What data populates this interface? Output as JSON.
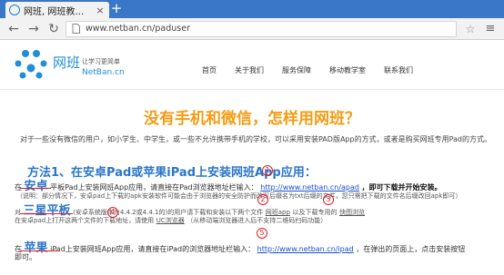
{
  "browser": {
    "tab_title": "网班, 网班教…",
    "url": "www.netban.cn/paduser"
  },
  "site": {
    "logo_cn": "网班",
    "logo_slogan": "让学习更简单",
    "logo_en": "NetBan.cn",
    "nav": [
      "首页",
      "关于我们",
      "服务保障",
      "移动教学室",
      "联系我们"
    ]
  },
  "content": {
    "title": "没有手机和微信，怎样用网班？",
    "intro": "对于一些没有微信的用户，如小学生、中学生，或一些不允许携带手机的学校，可以采用安装PAD版App的方式，或者是购买网班专用Pad的方式。",
    "method1": "方法1、在安卓Pad或苹果iPad上安装网班App应用：",
    "android": {
      "prefix": "在",
      "brand": "安卓",
      "text": "平板Pad上安装网班App应用，请直接在Pad浏览器地址栏输入：",
      "link": "http://www.netban.cn/apad",
      "suffix": "，即可下载并开始安装。",
      "note": "（说明：部分情况下，安卓pad上下载的apk安装软件可能会由于浏览器的安全防护而改写后缀名为txt后缀的文件，您只需把下载的文件名后缀改回apk即可）"
    },
    "samsung": {
      "prefix": "对",
      "brand": "三星平板",
      "text1": "(安卓系统版本为4.4.2或4.4.1的)的用户请下载和安装以下两个文件",
      "link1": "网班app",
      "text2": "以及下载专用的",
      "link2": "快图浏览",
      "line2a": "在安卓pad上打开这两个文件的下载地址，请使用",
      "link3": "UC浏览器",
      "line2b": "（从移动端浏览器进入后不支持二维码扫码功能）"
    },
    "apple": {
      "prefix": "在",
      "brand": "苹果",
      "text": "iPad上安装网班App应用，请直接在iPad的浏览器地址栏输入：",
      "link": "http://www.netban.cn/ipad",
      "suffix": "，在弹出的页面上，点击安装按钮",
      "line2": "即可。"
    },
    "markers": [
      "1",
      "2",
      "3",
      "4",
      "5"
    ]
  },
  "colors": {
    "accent_orange": "#f39c12",
    "accent_blue": "#2b76c9",
    "annotation_red": "#e02020",
    "chrome_blue": "#3a77c9"
  }
}
